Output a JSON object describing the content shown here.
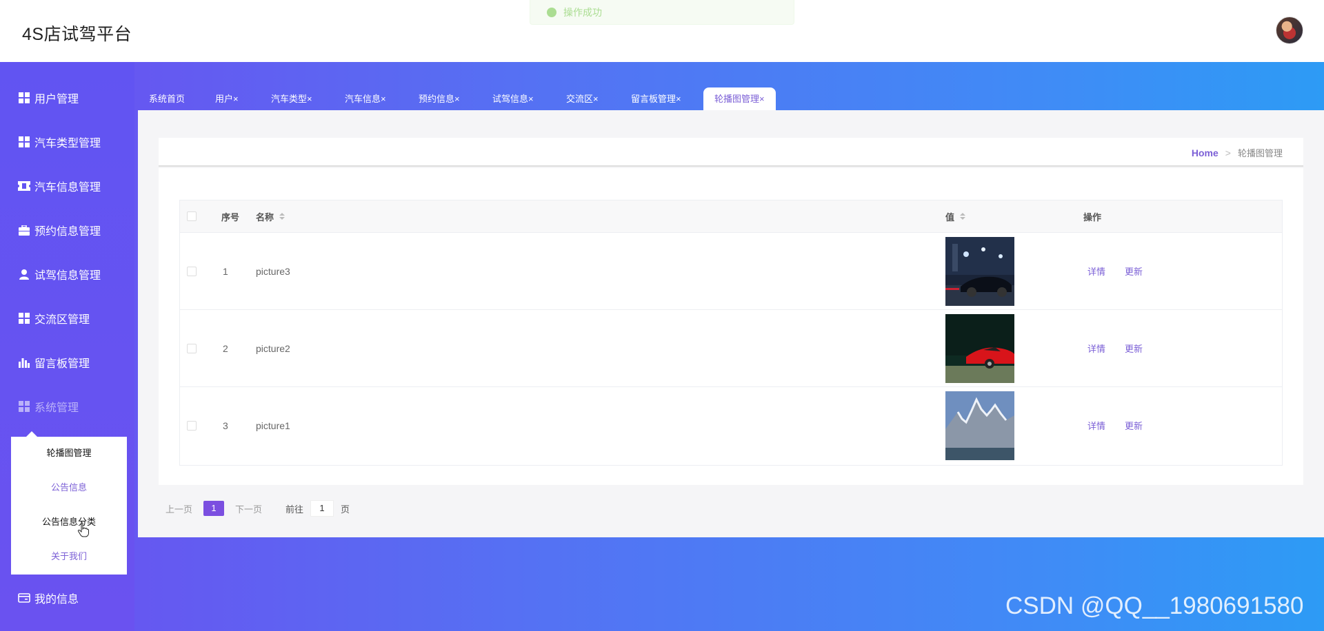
{
  "header": {
    "title": "4S店试驾平台",
    "toast": "操作成功"
  },
  "sidebar": {
    "items": [
      {
        "label": "用户管理",
        "icon": "grid-icon"
      },
      {
        "label": "汽车类型管理",
        "icon": "grid-icon"
      },
      {
        "label": "汽车信息管理",
        "icon": "ticket-icon"
      },
      {
        "label": "预约信息管理",
        "icon": "briefcase-icon"
      },
      {
        "label": "试驾信息管理",
        "icon": "user-icon"
      },
      {
        "label": "交流区管理",
        "icon": "grid-icon"
      },
      {
        "label": "留言板管理",
        "icon": "bar-chart-icon"
      },
      {
        "label": "系统管理",
        "icon": "grid-icon"
      }
    ],
    "submenu": [
      "轮播图管理",
      "公告信息",
      "公告信息分类",
      "关于我们"
    ],
    "my_info": "我的信息"
  },
  "tabs": [
    {
      "label": "系统首页"
    },
    {
      "label": "用户",
      "close": "×"
    },
    {
      "label": "汽车类型",
      "close": "×"
    },
    {
      "label": "汽车信息",
      "close": "×"
    },
    {
      "label": "预约信息",
      "close": "×"
    },
    {
      "label": "试驾信息",
      "close": "×"
    },
    {
      "label": "交流区",
      "close": "×"
    },
    {
      "label": "留言板管理",
      "close": "×"
    },
    {
      "label": "轮播图管理",
      "close": "×"
    }
  ],
  "breadcrumb": {
    "home": "Home",
    "sep": ">",
    "current": "轮播图管理"
  },
  "table": {
    "headers": {
      "index": "序号",
      "name": "名称",
      "value": "值",
      "ops": "操作"
    },
    "rows": [
      {
        "index": "1",
        "name": "picture3",
        "image": "car-at-night",
        "detail": "详情",
        "update": "更新"
      },
      {
        "index": "2",
        "name": "picture2",
        "image": "red-sports-car",
        "detail": "详情",
        "update": "更新"
      },
      {
        "index": "3",
        "name": "picture1",
        "image": "snowy-mountains",
        "detail": "详情",
        "update": "更新"
      }
    ]
  },
  "pagination": {
    "prev": "上一页",
    "current": "1",
    "next": "下一页",
    "goto_label": "前往",
    "goto_value": "1",
    "page_unit": "页"
  },
  "watermark": "CSDN @QQ__1980691580",
  "colors": {
    "accent": "#7b5fd6",
    "sidebar": "#6154f2",
    "gradient_end": "#2d9bf5"
  }
}
